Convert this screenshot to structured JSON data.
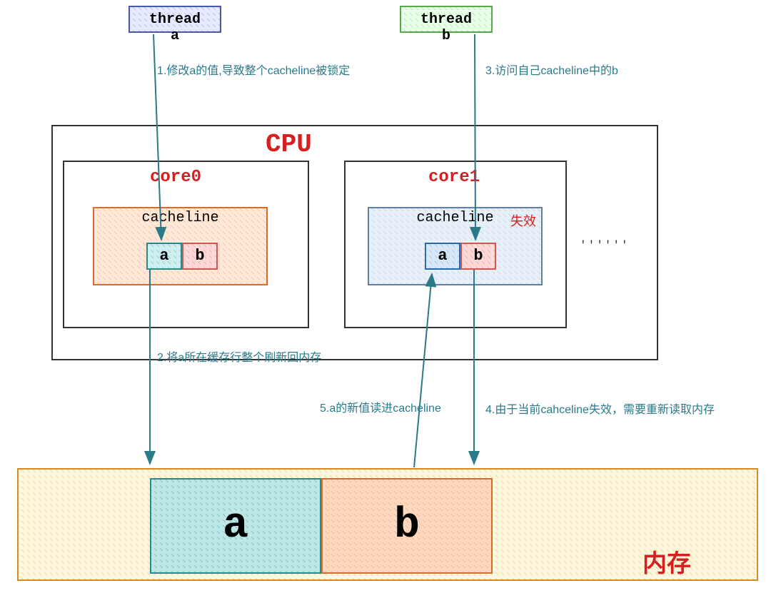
{
  "threads": {
    "a": "thread a",
    "b": "thread b"
  },
  "cpu": {
    "title": "CPU",
    "core0": {
      "label": "core0",
      "cacheline": "cacheline",
      "a": "a",
      "b": "b"
    },
    "core1": {
      "label": "core1",
      "cacheline": "cacheline",
      "invalid": "失效",
      "a": "a",
      "b": "b"
    },
    "ellipsis": "''''''"
  },
  "memory": {
    "label": "内存",
    "a": "a",
    "b": "b"
  },
  "annotations": {
    "step1": "1.修改a的值,导致整个cacheline被锁定",
    "step2": "2.将a所在缓存行整个刷新回内存",
    "step3": "3.访问自己cacheline中的b",
    "step4": "4.由于当前cahceline失效，需要重新读取内存",
    "step5": "5.a的新值读进cacheline"
  },
  "colors": {
    "arrow": "#2a7a8a",
    "red": "#d42020"
  }
}
